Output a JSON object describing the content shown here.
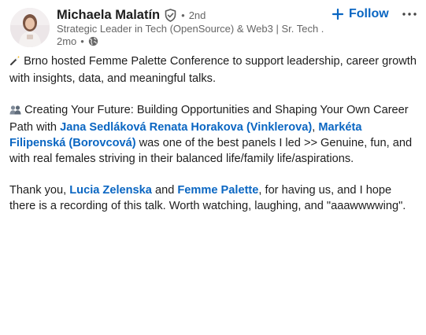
{
  "author": {
    "name": "Michaela Malatín",
    "degree": "2nd",
    "headline": "Strategic Leader in Tech (OpenSource) & Web3 | Sr. Tech ...",
    "time_ago": "2mo",
    "verified_icon": "verified-shield-icon",
    "visibility_icon": "globe-icon"
  },
  "actions": {
    "follow_label": "Follow",
    "more_icon": "ellipsis-icon"
  },
  "colors": {
    "link": "#0a66c2",
    "text": "#1d1d1d",
    "muted": "#666666"
  },
  "post": {
    "p1": {
      "emoji": "magic-wand-icon",
      "text": "Brno hosted Femme Palette Conference to support leadership, career growth with insights, data, and meaningful talks."
    },
    "p2": {
      "emoji": "people-icon",
      "text_before": "Creating Your Future: Building Opportunities and Shaping Your Own Career Path with",
      "mention_1": "Jana Sedláková Renata Horakova (Vinklerova)",
      "comma": ",",
      "mention_2": "Markéta Filipenská (Borovcová)",
      "text_after": "was one of the best panels I led >> Genuine, fun, and with real females striving in their balanced life/family life/aspirations."
    },
    "p3": {
      "text_before": "Thank you,",
      "mention_1": "Lucia Zelenska",
      "and": "and",
      "mention_2": "Femme Palette",
      "text_after": ", for having us, and I hope there is a recording of this talk. Worth watching, laughing, and \"aaawwwwing\"."
    }
  }
}
